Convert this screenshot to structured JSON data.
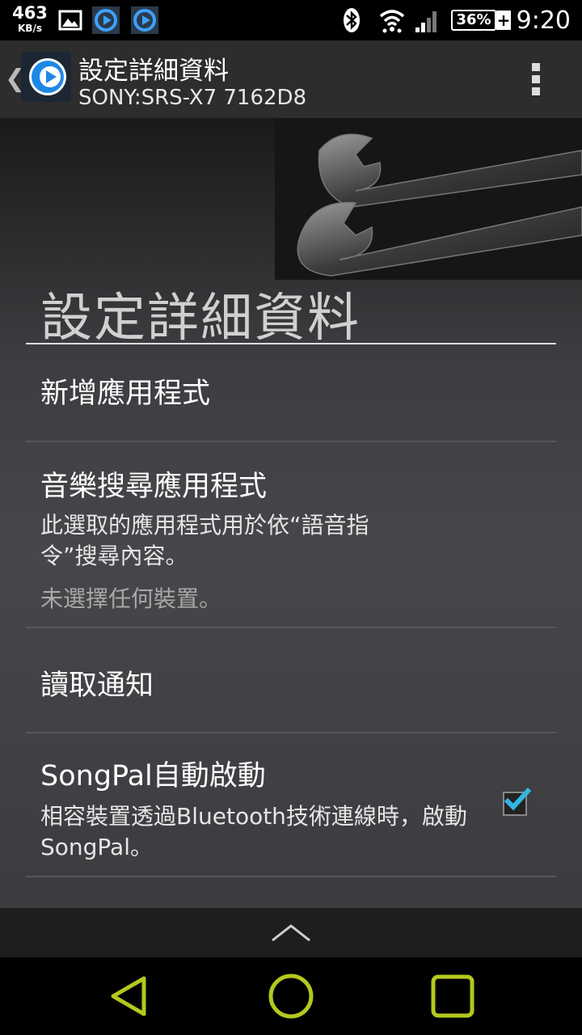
{
  "status_bar": {
    "net_speed": "463",
    "net_speed_unit": "KB/s",
    "battery": "36%",
    "battery_plus": "+",
    "time": "9:20"
  },
  "action_bar": {
    "title": "設定詳細資料",
    "subtitle": "SONY:SRS-X7 7162D8"
  },
  "page": {
    "header": "設定詳細資料"
  },
  "items": [
    {
      "title": "新增應用程式"
    },
    {
      "title": "音樂搜尋應用程式",
      "summary": "此選取的應用程式用於依“語音指令”搜尋內容。",
      "status": "未選擇任何裝置。"
    },
    {
      "title": "讀取通知"
    },
    {
      "title": "SongPal自動啟動",
      "summary": "相容裝置透過Bluetooth技術連線時，啟動SongPal。",
      "checked": true
    }
  ],
  "colors": {
    "nav_accent": "#b4c81e",
    "check_accent": "#33b5e5",
    "app_icon_blue": "#1e88e5"
  },
  "icons": {
    "status_left": [
      "image-icon",
      "songpal-icon",
      "songpal-icon"
    ],
    "status_right": [
      "bluetooth-icon",
      "wifi-icon",
      "signal-icon",
      "battery-icon"
    ],
    "nav": [
      "back-icon",
      "home-icon",
      "recents-icon"
    ]
  }
}
